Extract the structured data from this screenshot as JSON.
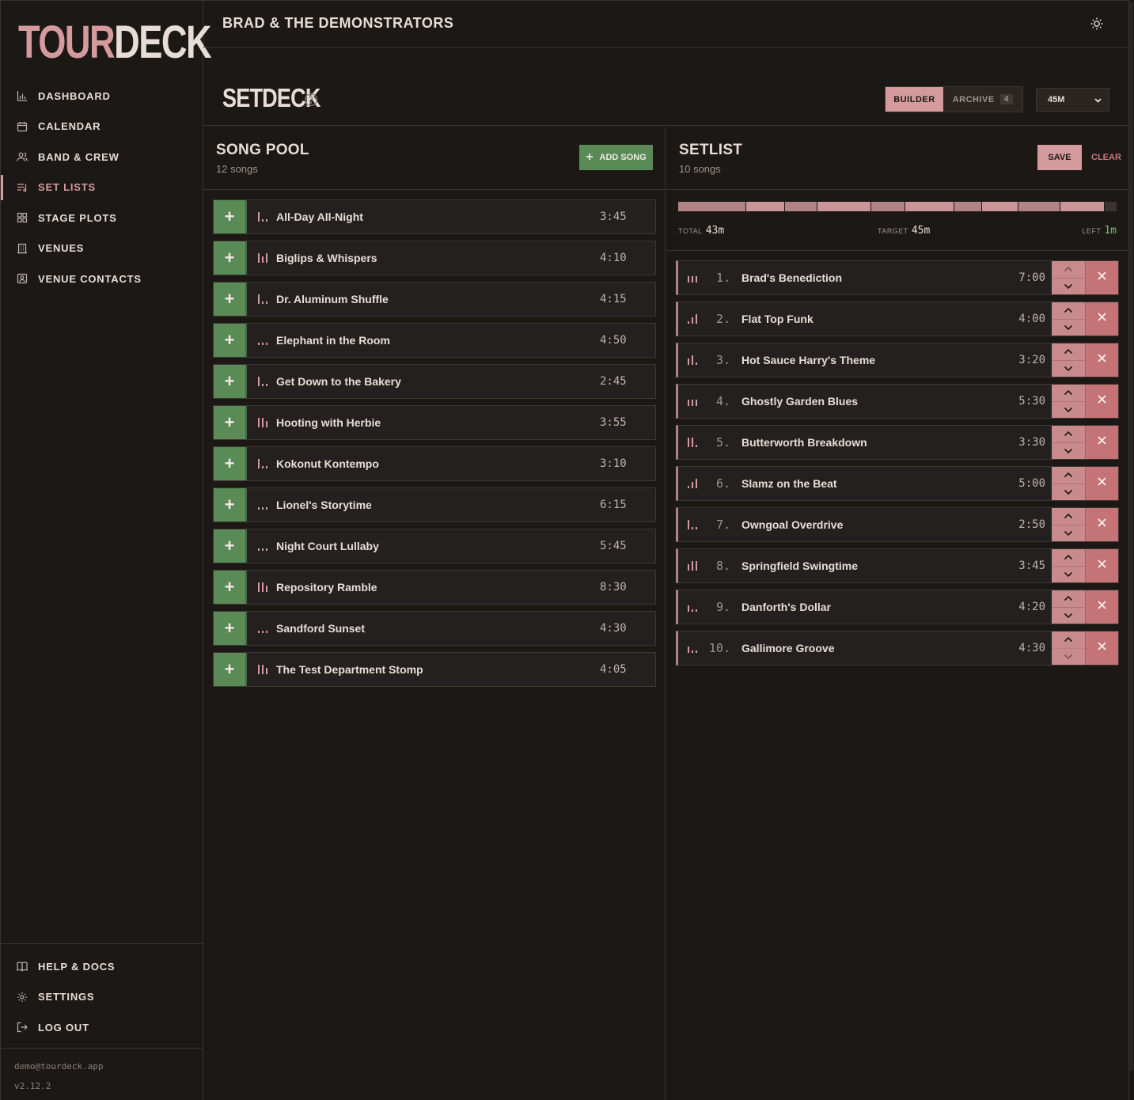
{
  "logo": {
    "part_a": "TOUR",
    "part_b": "DECK"
  },
  "nav": [
    {
      "label": "DASHBOARD",
      "icon": "chart-icon",
      "active": false
    },
    {
      "label": "CALENDAR",
      "icon": "calendar-icon",
      "active": false
    },
    {
      "label": "BAND & CREW",
      "icon": "users-icon",
      "active": false
    },
    {
      "label": "SET LISTS",
      "icon": "setlist-icon",
      "active": true
    },
    {
      "label": "STAGE PLOTS",
      "icon": "grid-icon",
      "active": false
    },
    {
      "label": "VENUES",
      "icon": "building-icon",
      "active": false
    },
    {
      "label": "VENUE CONTACTS",
      "icon": "contact-icon",
      "active": false
    }
  ],
  "bottom_nav": [
    {
      "label": "HELP & DOCS",
      "icon": "book-icon"
    },
    {
      "label": "SETTINGS",
      "icon": "gear-icon"
    },
    {
      "label": "LOG OUT",
      "icon": "logout-icon"
    }
  ],
  "footer": {
    "email": "demo@tourdeck.app",
    "version": "v2.12.2"
  },
  "header": {
    "band_name": "BRAD & THE DEMONSTRATORS",
    "theme_icon": "sun-icon"
  },
  "page": {
    "title": "SETDECK",
    "help_icon": "help-circle-icon",
    "tabs": {
      "builder": "BUILDER",
      "archive": "ARCHIVE",
      "archive_count": "4"
    },
    "length_select": "45M"
  },
  "pool": {
    "title": "SONG POOL",
    "count": "12 songs",
    "add_label": "ADD SONG",
    "songs": [
      {
        "name": "All-Day All-Night",
        "duration": "3:45",
        "energy": [
          3,
          1,
          1
        ]
      },
      {
        "name": "Biglips & Whispers",
        "duration": "4:10",
        "energy": [
          3,
          2,
          3
        ]
      },
      {
        "name": "Dr. Aluminum Shuffle",
        "duration": "4:15",
        "energy": [
          3,
          1,
          1
        ]
      },
      {
        "name": "Elephant in the Room",
        "duration": "4:50",
        "energy": [
          1,
          1,
          1
        ]
      },
      {
        "name": "Get Down to the Bakery",
        "duration": "2:45",
        "energy": [
          3,
          1,
          1
        ]
      },
      {
        "name": "Hooting with Herbie",
        "duration": "3:55",
        "energy": [
          3,
          3,
          2
        ]
      },
      {
        "name": "Kokonut Kontempo",
        "duration": "3:10",
        "energy": [
          3,
          1,
          1
        ]
      },
      {
        "name": "Lionel's Storytime",
        "duration": "6:15",
        "energy": [
          1,
          1,
          1
        ]
      },
      {
        "name": "Night Court Lullaby",
        "duration": "5:45",
        "energy": [
          1,
          1,
          1
        ]
      },
      {
        "name": "Repository Ramble",
        "duration": "8:30",
        "energy": [
          3,
          3,
          2
        ]
      },
      {
        "name": "Sandford Sunset",
        "duration": "4:30",
        "energy": [
          1,
          1,
          1
        ]
      },
      {
        "name": "The Test Department Stomp",
        "duration": "4:05",
        "energy": [
          3,
          3,
          2
        ]
      }
    ]
  },
  "setlist": {
    "title": "SETLIST",
    "count": "10 songs",
    "save_label": "SAVE",
    "clear_label": "CLEAR",
    "stats": {
      "total_label": "TOTAL",
      "total": "43m",
      "target_label": "TARGET",
      "target": "45m",
      "left_label": "LEFT",
      "left": "1m"
    },
    "target_minutes": 45,
    "songs": [
      {
        "num": "1.",
        "name": "Brad's Benediction",
        "duration": "7:00",
        "minutes": 7.0,
        "energy": [
          2,
          2,
          2
        ]
      },
      {
        "num": "2.",
        "name": "Flat Top Funk",
        "duration": "4:00",
        "minutes": 4.0,
        "energy": [
          1,
          2,
          3
        ]
      },
      {
        "num": "3.",
        "name": "Hot Sauce Harry's Theme",
        "duration": "3:20",
        "minutes": 3.333,
        "energy": [
          2,
          3,
          1
        ]
      },
      {
        "num": "4.",
        "name": "Ghostly Garden Blues",
        "duration": "5:30",
        "minutes": 5.5,
        "energy": [
          2,
          2,
          2
        ]
      },
      {
        "num": "5.",
        "name": "Butterworth Breakdown",
        "duration": "3:30",
        "minutes": 3.5,
        "energy": [
          3,
          3,
          1
        ]
      },
      {
        "num": "6.",
        "name": "Slamz on the Beat",
        "duration": "5:00",
        "minutes": 5.0,
        "energy": [
          1,
          2,
          3
        ]
      },
      {
        "num": "7.",
        "name": "Owngoal Overdrive",
        "duration": "2:50",
        "minutes": 2.833,
        "energy": [
          3,
          1,
          1
        ]
      },
      {
        "num": "8.",
        "name": "Springfield Swingtime",
        "duration": "3:45",
        "minutes": 3.75,
        "energy": [
          2,
          3,
          3
        ]
      },
      {
        "num": "9.",
        "name": "Danforth's Dollar",
        "duration": "4:20",
        "minutes": 4.333,
        "energy": [
          2,
          1,
          1
        ]
      },
      {
        "num": "10.",
        "name": "Gallimore Groove",
        "duration": "4:30",
        "minutes": 4.5,
        "energy": [
          2,
          1,
          1
        ]
      }
    ]
  },
  "colors": {
    "accent": "#d49a9c",
    "green": "#5a8a55",
    "remove": "#c47476",
    "background": "#1c1816"
  }
}
